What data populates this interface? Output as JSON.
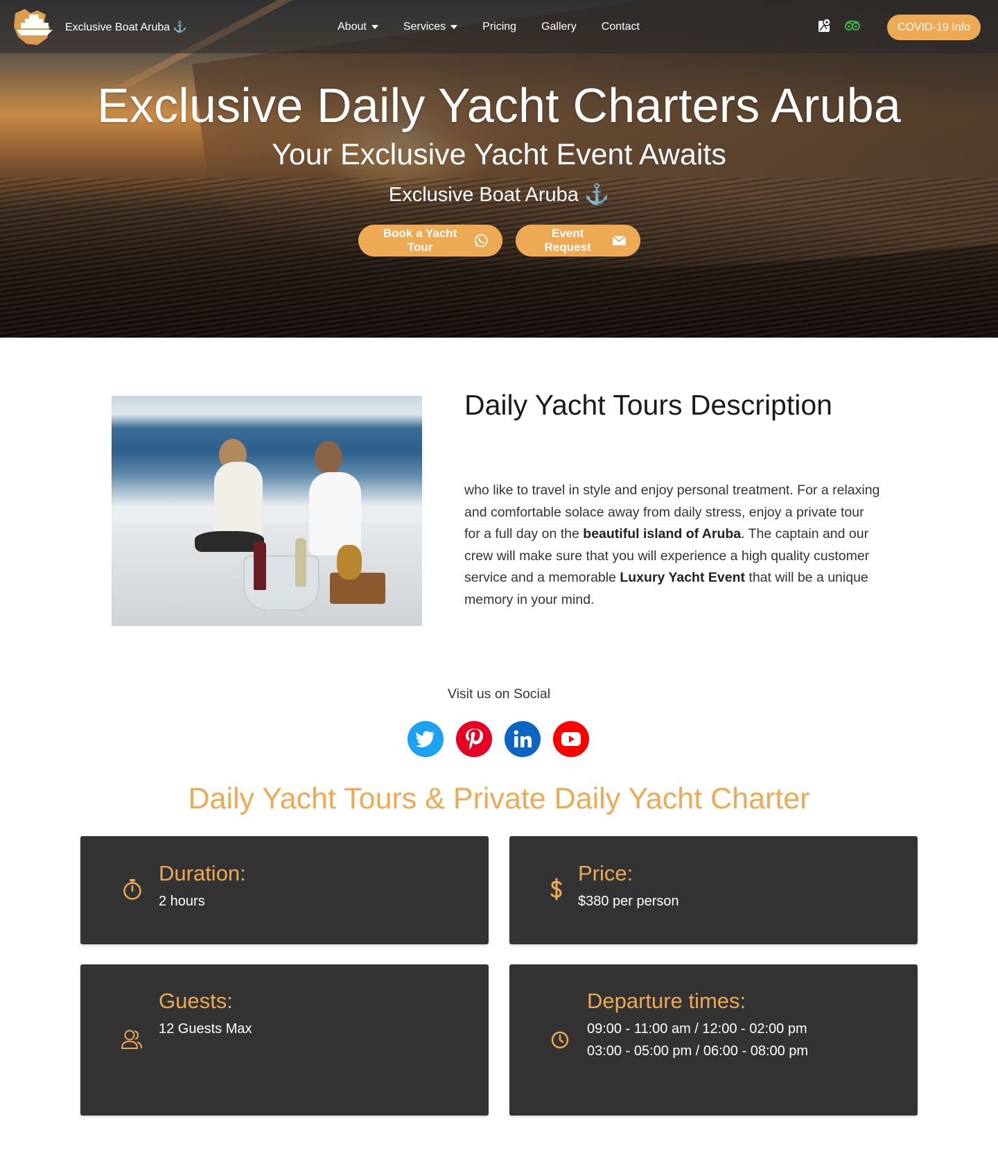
{
  "nav": {
    "brand": "Exclusive Boat Aruba ⚓",
    "links": [
      {
        "label": "About",
        "dropdown": true
      },
      {
        "label": "Services",
        "dropdown": true
      },
      {
        "label": "Pricing",
        "dropdown": false
      },
      {
        "label": "Gallery",
        "dropdown": false
      },
      {
        "label": "Contact",
        "dropdown": false
      }
    ],
    "covid_button": "COVID-19 Info"
  },
  "hero": {
    "title": "Exclusive Daily Yacht Charters Aruba",
    "subtitle": "Your Exclusive Yacht Event Awaits",
    "brand": "Exclusive Boat Aruba ⚓",
    "book_button": "Book a Yacht Tour",
    "event_button": "Event Request"
  },
  "description": {
    "title": "Daily Yacht Tours Description",
    "text_1": "who like to travel in style and enjoy personal treatment. For a relaxing and comfortable solace away from daily stress, enjoy a private tour for a full day on the ",
    "bold_1": "beautiful island of Aruba",
    "text_2": ". The captain and our crew will make sure that you will experience a high quality customer service and a memorable ",
    "bold_2": "Luxury Yacht Event",
    "text_3": " that will be a unique memory in your mind."
  },
  "social": {
    "label": "Visit us on Social",
    "icons": [
      "twitter-icon",
      "pinterest-icon",
      "linkedin-icon",
      "youtube-icon"
    ]
  },
  "tours": {
    "title": "Daily Yacht Tours & Private Daily Yacht Charter",
    "duration": {
      "title": "Duration:",
      "value": "2 hours"
    },
    "price": {
      "title": "Price:",
      "value": "$380 per person"
    },
    "guests": {
      "title": "Guests:",
      "value": "12 Guests Max"
    },
    "departure": {
      "title": "Departure times:",
      "line_1": "09:00 - 11:00 am / 12:00 - 02:00 pm",
      "line_2": "03:00 - 05:00 pm / 06:00 - 08:00 pm"
    }
  },
  "colors": {
    "accent": "#eea954",
    "card": "#333333"
  }
}
